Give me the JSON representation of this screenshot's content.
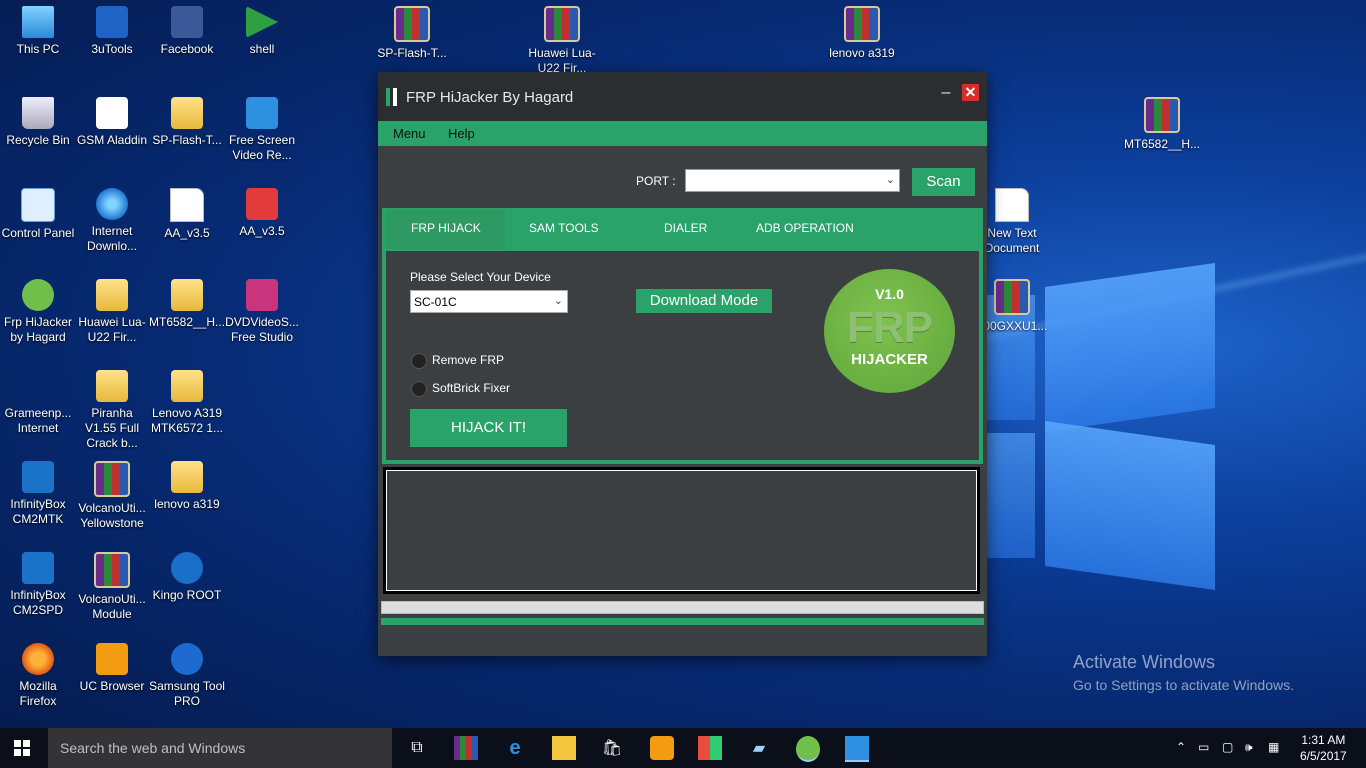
{
  "desktop_icons": [
    {
      "label": "This PC",
      "icon": "pc-icon",
      "cls": "pc",
      "x": 0,
      "y": 0
    },
    {
      "label": "3uTools",
      "icon": "3utools-icon",
      "cls": "tool3",
      "x": 1,
      "y": 0
    },
    {
      "label": "Facebook",
      "icon": "facebook-icon",
      "cls": "fb",
      "x": 2,
      "y": 0
    },
    {
      "label": "shell",
      "icon": "shell-icon",
      "cls": "sh",
      "x": 3,
      "y": 0
    },
    {
      "label": "Recycle Bin",
      "icon": "recycle-bin-icon",
      "cls": "bin",
      "x": 0,
      "y": 1
    },
    {
      "label": "GSM Aladdin",
      "icon": "gsm-aladdin-icon",
      "cls": "rr",
      "x": 1,
      "y": 1
    },
    {
      "label": "SP-Flash-T...",
      "icon": "folder-icon",
      "cls": "folder",
      "x": 2,
      "y": 1
    },
    {
      "label": "Free Screen Video Re...",
      "icon": "screen-recorder-icon",
      "cls": "scr",
      "x": 3,
      "y": 1
    },
    {
      "label": "Control Panel",
      "icon": "control-panel-icon",
      "cls": "cp",
      "x": 0,
      "y": 2
    },
    {
      "label": "Internet Downlo...",
      "icon": "internet-download-icon",
      "cls": "ie",
      "x": 1,
      "y": 2
    },
    {
      "label": "AA_v3.5",
      "icon": "document-icon",
      "cls": "doc",
      "x": 2,
      "y": 2
    },
    {
      "label": "AA_v3.5",
      "icon": "aa-app-icon",
      "cls": "aa",
      "x": 3,
      "y": 2
    },
    {
      "label": "Frp HiJacker by Hagard",
      "icon": "frp-hijacker-icon",
      "cls": "frp",
      "x": 0,
      "y": 3
    },
    {
      "label": "Huawei Lua-U22 Fir...",
      "icon": "folder-icon",
      "cls": "folder",
      "x": 1,
      "y": 3
    },
    {
      "label": "MT6582__H...",
      "icon": "folder-icon",
      "cls": "folder",
      "x": 2,
      "y": 3
    },
    {
      "label": "DVDVideoS... Free Studio",
      "icon": "dvd-studio-icon",
      "cls": "fs",
      "x": 3,
      "y": 3
    },
    {
      "label": "Grameenp... Internet",
      "icon": "antenna-icon",
      "cls": "ant",
      "x": 0,
      "y": 4
    },
    {
      "label": "Piranha V1.55 Full Crack b...",
      "icon": "folder-icon",
      "cls": "folder",
      "x": 1,
      "y": 4
    },
    {
      "label": "Lenovo A319 MTK6572 1...",
      "icon": "folder-icon",
      "cls": "folder",
      "x": 2,
      "y": 4
    },
    {
      "label": "InfinityBox CM2MTK",
      "icon": "infinitybox-icon",
      "cls": "mtk",
      "x": 0,
      "y": 5
    },
    {
      "label": "VolcanoUti... Yellowstone",
      "icon": "winrar-icon",
      "cls": "rar",
      "x": 1,
      "y": 5
    },
    {
      "label": "lenovo a319",
      "icon": "folder-icon",
      "cls": "folder",
      "x": 2,
      "y": 5
    },
    {
      "label": "InfinityBox CM2SPD",
      "icon": "infinitybox-icon",
      "cls": "mtk",
      "x": 0,
      "y": 6
    },
    {
      "label": "VolcanoUti... Module",
      "icon": "winrar-icon",
      "cls": "rar",
      "x": 1,
      "y": 6
    },
    {
      "label": "Kingo ROOT",
      "icon": "kingo-root-icon",
      "cls": "kr",
      "x": 2,
      "y": 6
    },
    {
      "label": "Mozilla Firefox",
      "icon": "firefox-icon",
      "cls": "fox",
      "x": 0,
      "y": 7
    },
    {
      "label": "UC Browser",
      "icon": "uc-browser-icon",
      "cls": "uc",
      "x": 1,
      "y": 7
    },
    {
      "label": "Samsung Tool PRO",
      "icon": "samsung-tool-icon",
      "cls": "sam",
      "x": 2,
      "y": 7
    }
  ],
  "extra_icons": [
    {
      "label": "SP-Flash-T...",
      "icon": "winrar-icon",
      "cls": "rar"
    },
    {
      "label": "Huawei Lua-U22 Fir...",
      "icon": "winrar-icon",
      "cls": "rar"
    },
    {
      "label": "lenovo a319",
      "icon": "winrar-icon",
      "cls": "rar"
    },
    {
      "label": "MT6582__H...",
      "icon": "winrar-icon",
      "cls": "rar"
    },
    {
      "label": "New Text Document",
      "icon": "text-document-icon",
      "cls": "doc"
    },
    {
      "label": "500GXXU1...",
      "icon": "winrar-icon",
      "cls": "rar"
    }
  ],
  "window": {
    "title": "FRP HiJacker By Hagard",
    "minimize": "–",
    "close": "✕",
    "menu": {
      "menu": "Menu",
      "help": "Help"
    },
    "port_label": "PORT :",
    "port_value": "",
    "scan": "Scan",
    "tabs": {
      "frp": "FRP HIJACK",
      "sam": "SAM TOOLS",
      "dialer": "DIALER",
      "adb": "ADB OPERATION"
    },
    "select_label": "Please Select Your Device",
    "device": "SC-01C",
    "download_mode": "Download Mode",
    "remove_frp": "Remove FRP",
    "softbrick": "SoftBrick Fixer",
    "hijack": "HIJACK IT!",
    "logo": {
      "version": "V1.0",
      "frp": "FRP",
      "hijacker": "HIJACKER"
    },
    "accent": "#2aa36a"
  },
  "activate": {
    "line1": "Activate Windows",
    "line2": "Go to Settings to activate Windows."
  },
  "taskbar": {
    "search": "Search the web and Windows",
    "time": "1:31 AM",
    "date": "6/5/2017"
  }
}
